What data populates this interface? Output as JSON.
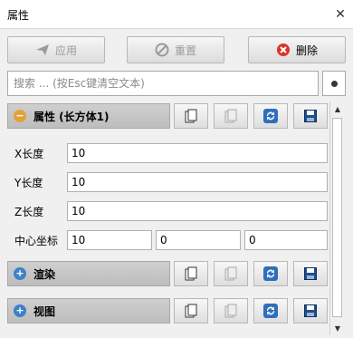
{
  "window": {
    "title": "属性",
    "close_glyph": "✕"
  },
  "toolbar": {
    "apply_label": "应用",
    "reset_label": "重置",
    "delete_label": "删除"
  },
  "search": {
    "placeholder": "搜索 ... (按Esc键清空文本)",
    "value": ""
  },
  "sections": {
    "properties": {
      "title": "属性 (长方体1)",
      "expanded": true
    },
    "render": {
      "title": "渲染",
      "expanded": false
    },
    "view": {
      "title": "视图",
      "expanded": false
    }
  },
  "fields": {
    "x_length": {
      "label": "X长度",
      "value": "10"
    },
    "y_length": {
      "label": "Y长度",
      "value": "10"
    },
    "z_length": {
      "label": "Z长度",
      "value": "10"
    },
    "center": {
      "label": "中心坐标",
      "x": "10",
      "y": "0",
      "z": "0"
    }
  },
  "icons": {
    "apply": "send-icon",
    "reset": "reset-icon",
    "delete": "delete-icon",
    "copy": "copy-icon",
    "paste": "paste-icon",
    "refresh": "refresh-icon",
    "save": "save-icon"
  },
  "colors": {
    "delete_icon": "#d9342b",
    "collapse_icon": "#e2a23a",
    "expand_icon": "#3c82c8",
    "refresh_icon": "#2f6fba",
    "save_icon": "#1f4e8c"
  }
}
